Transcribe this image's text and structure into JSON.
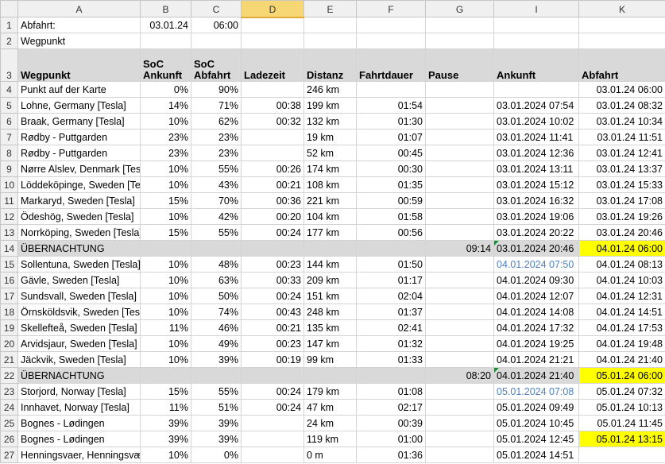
{
  "columns": [
    "A",
    "B",
    "C",
    "D",
    "E",
    "F",
    "G",
    "I",
    "K"
  ],
  "active_column": "D",
  "row_numbers": [
    "1",
    "2",
    "3",
    "4",
    "5",
    "6",
    "7",
    "8",
    "9",
    "10",
    "11",
    "12",
    "13",
    "14",
    "15",
    "16",
    "17",
    "18",
    "19",
    "20",
    "21",
    "22",
    "23",
    "24",
    "25",
    "26",
    "27"
  ],
  "row1": {
    "label": "Abfahrt:",
    "date": "03.01.24",
    "time": "06:00"
  },
  "row2": {
    "label": "Wegpunkt"
  },
  "headers": {
    "wegpunkt": "Wegpunkt",
    "soc_ankunft_1": "SoC",
    "soc_ankunft_2": "Ankunft",
    "soc_abfahrt_1": "SoC",
    "soc_abfahrt_2": "Abfahrt",
    "ladezeit": "Ladezeit",
    "distanz": "Distanz",
    "fahrtdauer": "Fahrtdauer",
    "pause": "Pause",
    "ankunft": "Ankunft",
    "abfahrt": "Abfahrt"
  },
  "rows": [
    {
      "a": "Punkt auf der Karte",
      "b": "0%",
      "c": "90%",
      "d": "",
      "e": "246 km",
      "f": "",
      "g": "",
      "i": "",
      "k": "03.01.24 06:00"
    },
    {
      "a": "Lohne, Germany [Tesla]",
      "b": "14%",
      "c": "71%",
      "d": "00:38",
      "e": "199 km",
      "f": "01:54",
      "g": "",
      "i": "03.01.2024 07:54",
      "k": "03.01.24 08:32"
    },
    {
      "a": "Braak, Germany [Tesla]",
      "b": "10%",
      "c": "62%",
      "d": "00:32",
      "e": "132 km",
      "f": "01:30",
      "g": "",
      "i": "03.01.2024 10:02",
      "k": "03.01.24 10:34"
    },
    {
      "a": "Rødby - Puttgarden",
      "b": "23%",
      "c": "23%",
      "d": "",
      "e": "19 km",
      "f": "01:07",
      "g": "",
      "i": "03.01.2024 11:41",
      "k": "03.01.24 11:51"
    },
    {
      "a": "Rødby - Puttgarden",
      "b": "23%",
      "c": "23%",
      "d": "",
      "e": "52 km",
      "f": "00:45",
      "g": "",
      "i": "03.01.2024 12:36",
      "k": "03.01.24 12:41"
    },
    {
      "a": "Nørre Alslev, Denmark [Tesla]",
      "b": "10%",
      "c": "55%",
      "d": "00:26",
      "e": "174 km",
      "f": "00:30",
      "g": "",
      "i": "03.01.2024 13:11",
      "k": "03.01.24 13:37"
    },
    {
      "a": "Löddeköpinge, Sweden [Tesla]",
      "b": "10%",
      "c": "43%",
      "d": "00:21",
      "e": "108 km",
      "f": "01:35",
      "g": "",
      "i": "03.01.2024 15:12",
      "k": "03.01.24 15:33"
    },
    {
      "a": "Markaryd, Sweden [Tesla]",
      "b": "15%",
      "c": "70%",
      "d": "00:36",
      "e": "221 km",
      "f": "00:59",
      "g": "",
      "i": "03.01.2024 16:32",
      "k": "03.01.24 17:08"
    },
    {
      "a": "Ödeshög, Sweden [Tesla]",
      "b": "10%",
      "c": "42%",
      "d": "00:20",
      "e": "104 km",
      "f": "01:58",
      "g": "",
      "i": "03.01.2024 19:06",
      "k": "03.01.24 19:26"
    },
    {
      "a": "Norrköping, Sweden [Tesla]",
      "b": "15%",
      "c": "55%",
      "d": "00:24",
      "e": "177 km",
      "f": "00:56",
      "g": "",
      "i": "03.01.2024 20:22",
      "k": "03.01.24 20:46"
    },
    {
      "a": "ÜBERNACHTUNG",
      "b": "",
      "c": "",
      "d": "",
      "e": "",
      "f": "",
      "g": "09:14",
      "i": "03.01.2024 20:46",
      "k": "04.01.24 06:00",
      "gray": true,
      "k_yellow": true,
      "i_tri": true
    },
    {
      "a": "Sollentuna, Sweden [Tesla]",
      "b": "10%",
      "c": "48%",
      "d": "00:23",
      "e": "144 km",
      "f": "01:50",
      "g": "",
      "i": "04.01.2024 07:50",
      "k": "04.01.24 08:13",
      "i_blue": true
    },
    {
      "a": "Gävle, Sweden [Tesla]",
      "b": "10%",
      "c": "63%",
      "d": "00:33",
      "e": "209 km",
      "f": "01:17",
      "g": "",
      "i": "04.01.2024 09:30",
      "k": "04.01.24 10:03"
    },
    {
      "a": "Sundsvall, Sweden [Tesla]",
      "b": "10%",
      "c": "50%",
      "d": "00:24",
      "e": "151 km",
      "f": "02:04",
      "g": "",
      "i": "04.01.2024 12:07",
      "k": "04.01.24 12:31"
    },
    {
      "a": "Örnsköldsvik, Sweden [Tesla]",
      "b": "10%",
      "c": "74%",
      "d": "00:43",
      "e": "248 km",
      "f": "01:37",
      "g": "",
      "i": "04.01.2024 14:08",
      "k": "04.01.24 14:51"
    },
    {
      "a": "Skellefteå, Sweden [Tesla]",
      "b": "11%",
      "c": "46%",
      "d": "00:21",
      "e": "135 km",
      "f": "02:41",
      "g": "",
      "i": "04.01.2024 17:32",
      "k": "04.01.24 17:53"
    },
    {
      "a": "Arvidsjaur, Sweden [Tesla]",
      "b": "10%",
      "c": "49%",
      "d": "00:23",
      "e": "147 km",
      "f": "01:32",
      "g": "",
      "i": "04.01.2024 19:25",
      "k": "04.01.24 19:48"
    },
    {
      "a": "Jäckvik, Sweden [Tesla]",
      "b": "10%",
      "c": "39%",
      "d": "00:19",
      "e": "99 km",
      "f": "01:33",
      "g": "",
      "i": "04.01.2024 21:21",
      "k": "04.01.24 21:40"
    },
    {
      "a": "ÜBERNACHTUNG",
      "b": "",
      "c": "",
      "d": "",
      "e": "",
      "f": "",
      "g": "08:20",
      "i": "04.01.2024 21:40",
      "k": "05.01.24 06:00",
      "gray": true,
      "k_yellow": true,
      "i_tri": true
    },
    {
      "a": "Storjord, Norway [Tesla]",
      "b": "15%",
      "c": "55%",
      "d": "00:24",
      "e": "179 km",
      "f": "01:08",
      "g": "",
      "i": "05.01.2024 07:08",
      "k": "05.01.24 07:32",
      "i_blue": true
    },
    {
      "a": "Innhavet, Norway [Tesla]",
      "b": "11%",
      "c": "51%",
      "d": "00:24",
      "e": "47 km",
      "f": "02:17",
      "g": "",
      "i": "05.01.2024 09:49",
      "k": "05.01.24 10:13"
    },
    {
      "a": "Bognes - Lødingen",
      "b": "39%",
      "c": "39%",
      "d": "",
      "e": "24 km",
      "f": "00:39",
      "g": "",
      "i": "05.01.2024 10:45",
      "k": "05.01.24 11:45"
    },
    {
      "a": "Bognes - Lødingen",
      "b": "39%",
      "c": "39%",
      "d": "",
      "e": "119 km",
      "f": "01:00",
      "g": "",
      "i": "05.01.2024 12:45",
      "k": "05.01.24 13:15",
      "k_yellow": true
    },
    {
      "a": "Henningsvaer, Henningsvær",
      "b": "10%",
      "c": "0%",
      "d": "",
      "e": "0 m",
      "f": "01:36",
      "g": "",
      "i": "05.01.2024 14:51",
      "k": ""
    }
  ]
}
